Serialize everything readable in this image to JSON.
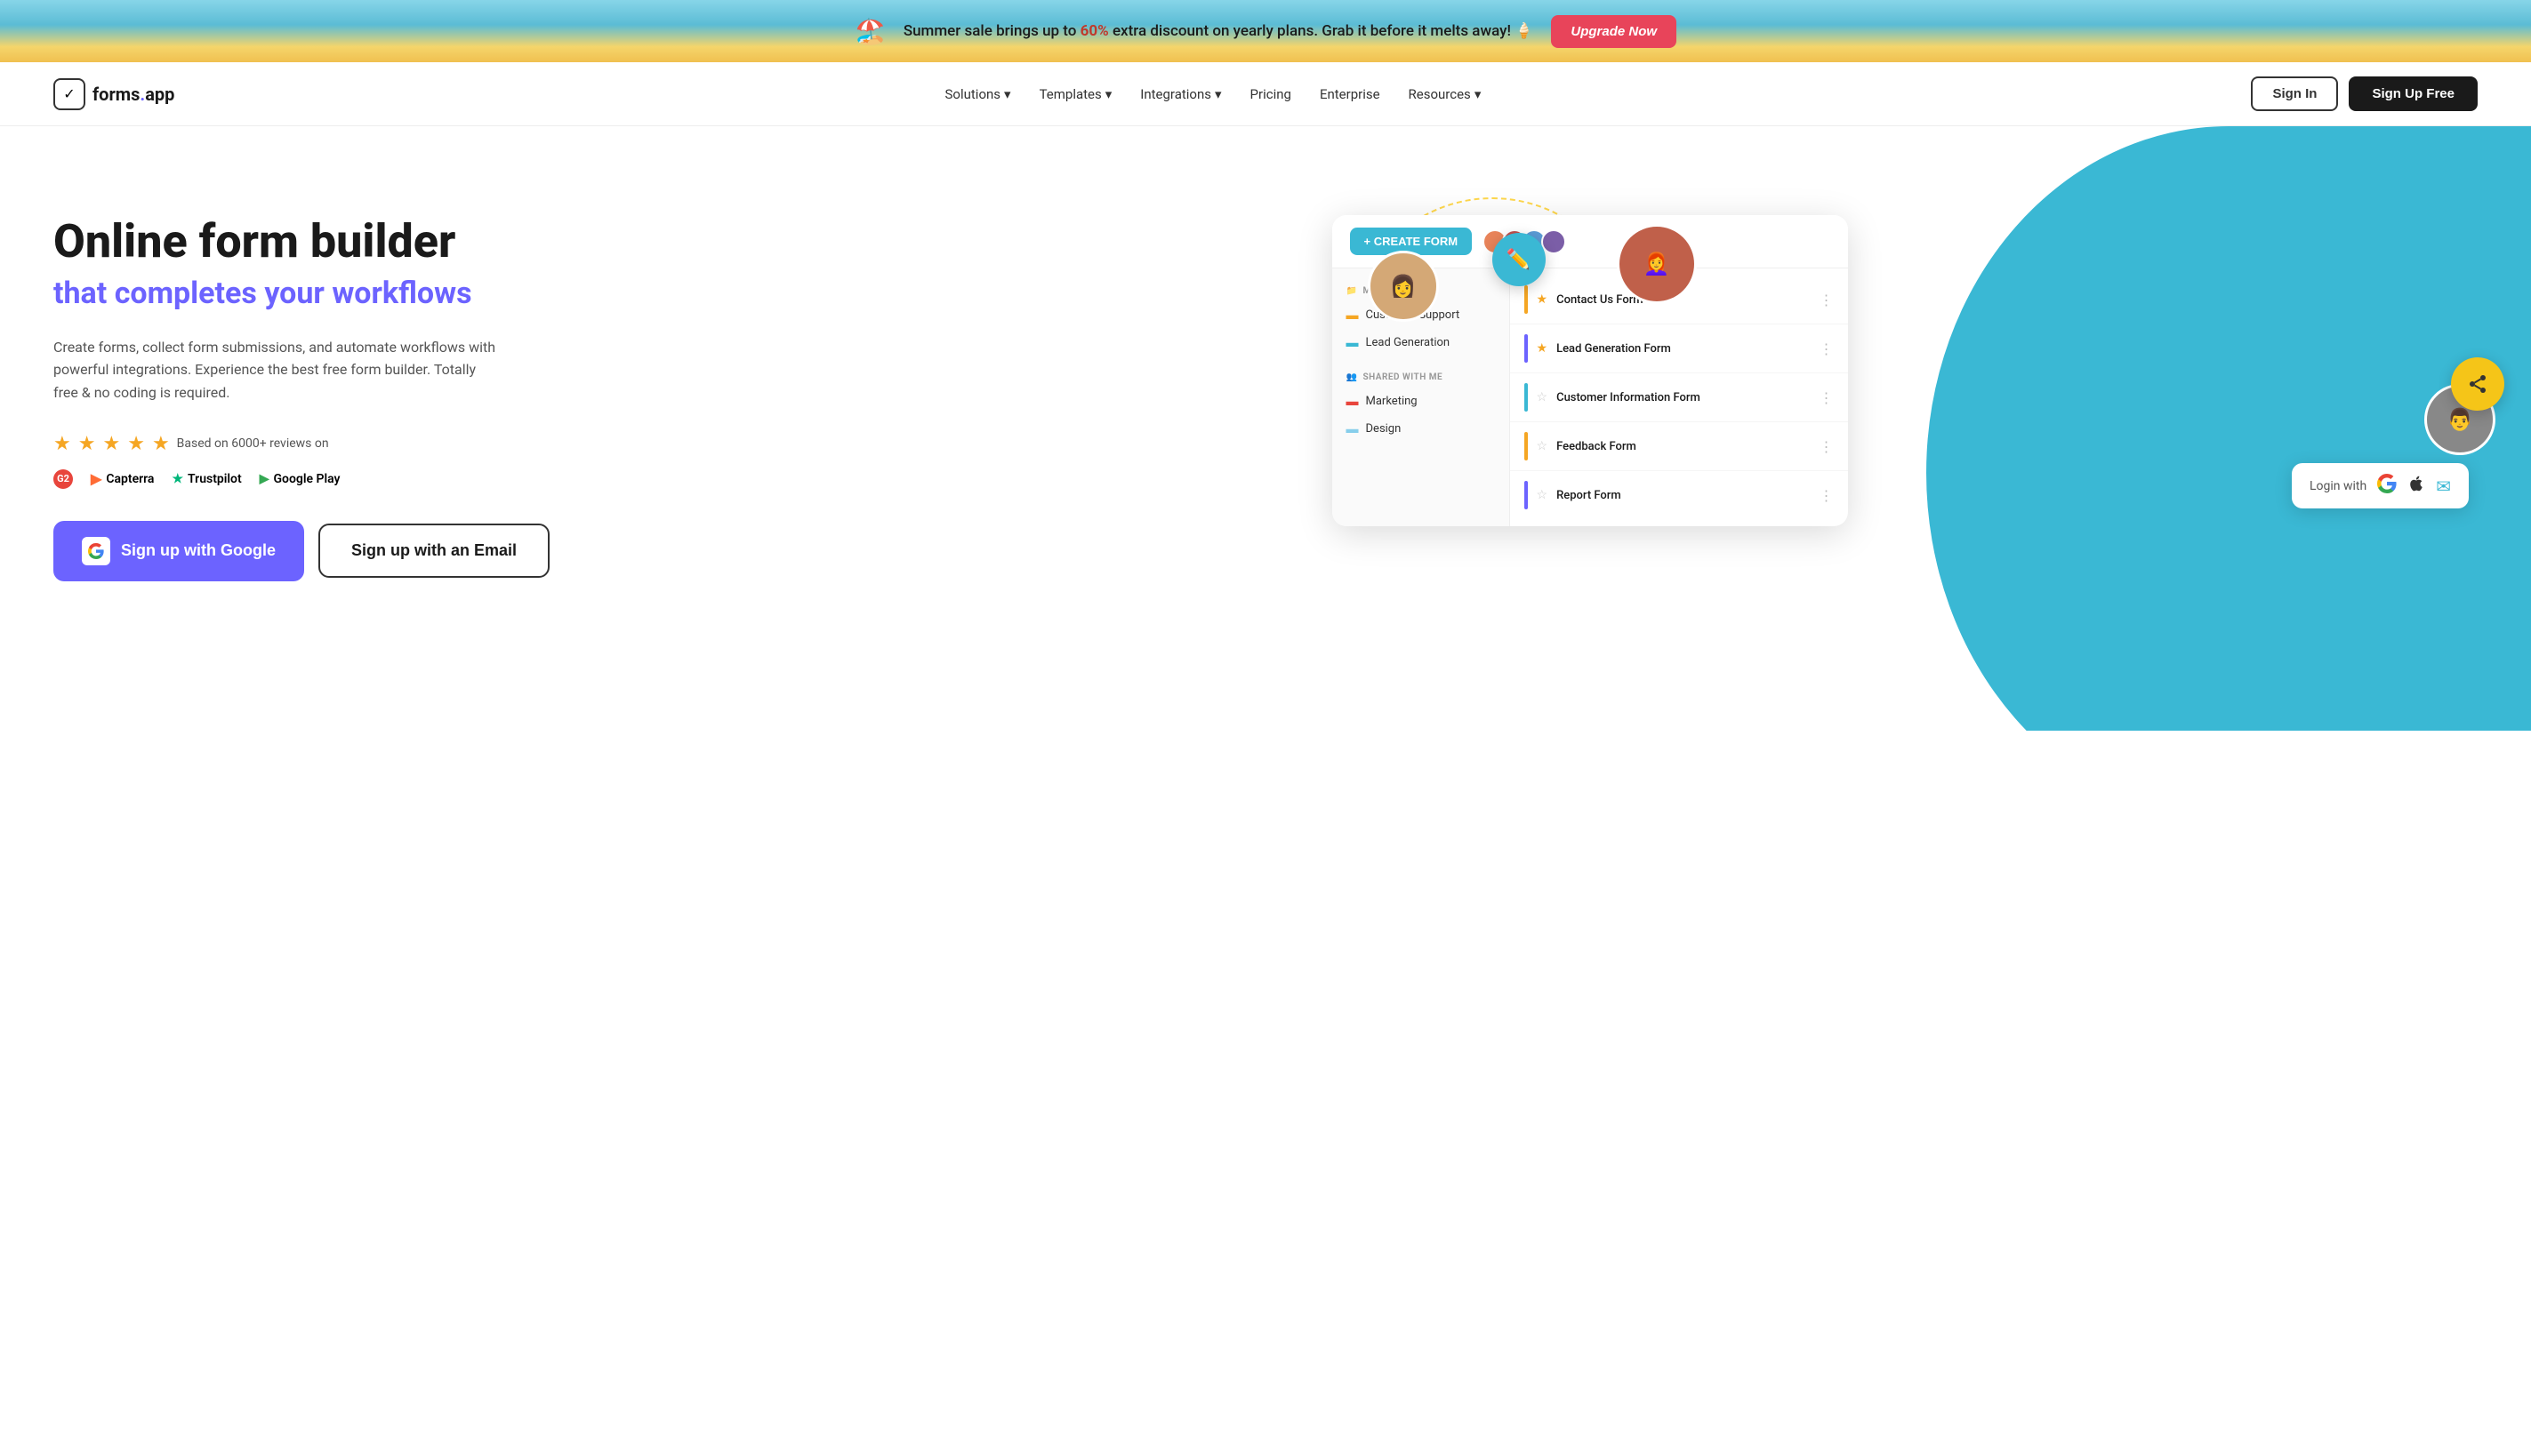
{
  "banner": {
    "text": "Summer sale brings up to 60% extra discount on yearly plans. Grab it before it melts away! 🍦",
    "discount": "60%",
    "btn_label": "Upgrade Now"
  },
  "navbar": {
    "logo_text": "forms",
    "logo_dot": ".",
    "logo_app": "app",
    "nav_items": [
      {
        "label": "Solutions",
        "has_dropdown": true
      },
      {
        "label": "Templates",
        "has_dropdown": true
      },
      {
        "label": "Integrations",
        "has_dropdown": true
      },
      {
        "label": "Pricing",
        "has_dropdown": false
      },
      {
        "label": "Enterprise",
        "has_dropdown": false
      },
      {
        "label": "Resources",
        "has_dropdown": true
      }
    ],
    "signin_label": "Sign In",
    "signup_label": "Sign Up Free"
  },
  "hero": {
    "title_line1": "Online form builder",
    "title_line2": "that completes your workflows",
    "description": "Create forms, collect form submissions, and automate workflows with powerful integrations. Experience the best free form builder. Totally free & no coding is required.",
    "review_text": "Based on 6000+ reviews on",
    "review_platforms": [
      {
        "name": "G2",
        "icon": "G2"
      },
      {
        "name": "Capterra",
        "icon": "▶"
      },
      {
        "name": "Trustpilot",
        "icon": "★"
      },
      {
        "name": "Google Play",
        "icon": "▶"
      }
    ],
    "btn_google": "Sign up with Google",
    "btn_email": "Sign up with an Email"
  },
  "dashboard": {
    "create_btn": "+ CREATE FORM",
    "my_forms_label": "MY FORMS",
    "shared_label": "SHARED WITH ME",
    "sidebar_my_forms": [
      {
        "label": "Customer Support",
        "color": "yellow"
      },
      {
        "label": "Lead Generation",
        "color": "blue"
      }
    ],
    "sidebar_shared": [
      {
        "label": "Marketing",
        "color": "red"
      },
      {
        "label": "Design",
        "color": "lightblue"
      }
    ],
    "forms_list": [
      {
        "title": "Contact Us Form",
        "starred": true,
        "color": "#f5a623"
      },
      {
        "title": "Lead Generation Form",
        "starred": true,
        "color": "#6c63ff"
      },
      {
        "title": "Customer Information Form",
        "starred": false,
        "color": "#3ab8d4"
      },
      {
        "title": "Feedback Form",
        "starred": false,
        "color": "#f5a623"
      },
      {
        "title": "Report Form",
        "starred": false,
        "color": "#6c63ff"
      }
    ]
  },
  "login_widget": {
    "label": "Login with"
  },
  "icons": {
    "pencil": "✏️",
    "share": "⋯",
    "chevron": "›",
    "dots": "⋮",
    "plus": "+"
  }
}
